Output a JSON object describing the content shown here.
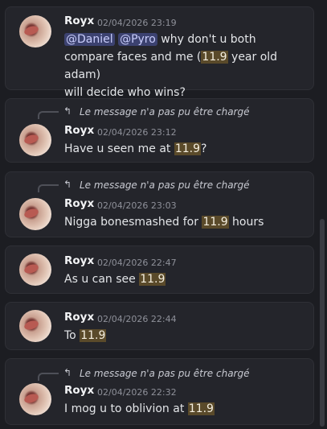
{
  "messages": [
    {
      "author": "Royx",
      "time": "02/04/2026 23:19",
      "reply": null,
      "mention1": "@Daniel",
      "mention2": "@Pyro",
      "text1": " why don't u both",
      "text2": "compare faces and me (",
      "hl": "11.9",
      "text3": " year old adam)",
      "text4": "will decide who wins?"
    },
    {
      "author": "Royx",
      "time": "02/04/2026 23:12",
      "reply": "Le message n'a pas pu être chargé",
      "pre": "Have u seen me at ",
      "hl": "11.9",
      "post": "?"
    },
    {
      "author": "Royx",
      "time": "02/04/2026 23:03",
      "reply": "Le message n'a pas pu être chargé",
      "pre": "Nigga bonesmashed for ",
      "hl": "11.9",
      "post": " hours"
    },
    {
      "author": "Royx",
      "time": "02/04/2026 22:47",
      "reply": null,
      "pre": "As u can see ",
      "hl": "11.9",
      "post": ""
    },
    {
      "author": "Royx",
      "time": "02/04/2026 22:44",
      "reply": null,
      "pre": "To ",
      "hl": "11.9",
      "post": ""
    },
    {
      "author": "Royx",
      "time": "02/04/2026 22:32",
      "reply": "Le message n'a pas pu être chargé",
      "pre": "I mog u to oblivion at ",
      "hl": "11.9",
      "post": ""
    }
  ],
  "colors": {
    "background": "#1c1d22",
    "card": "#24252b",
    "highlight": "#5a4a2a",
    "mention": "#3c4270"
  },
  "icons": {
    "reply": "reply-arrow-icon"
  }
}
